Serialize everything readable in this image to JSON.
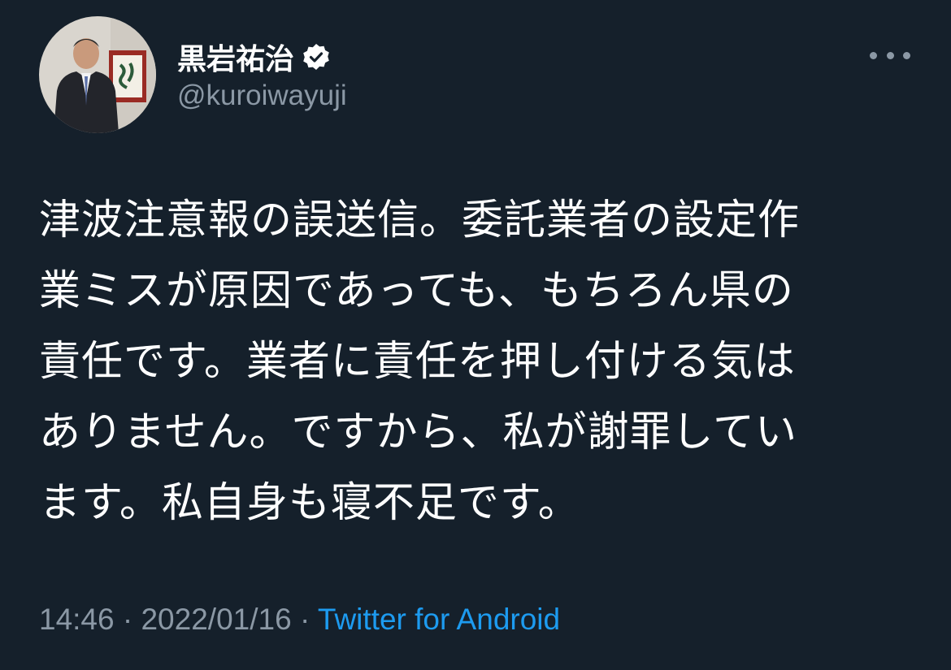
{
  "tweet": {
    "author": {
      "display_name": "黒岩祐治",
      "handle": "@kuroiwayuji",
      "verified": true,
      "avatar_icon": "profile-photo"
    },
    "more_icon": "more-horizontal-icon",
    "text_lines": [
      "津波注意報の誤送信。委託業者の設定作",
      "業ミスが原因であっても、もちろん県の",
      "責任です。業者に責任を押し付ける気は",
      "ありません。ですから、私が謝罪してい",
      "ます。私自身も寝不足です。"
    ],
    "time": "14:46",
    "separator": "·",
    "date": "2022/01/16",
    "source": "Twitter for Android"
  },
  "colors": {
    "background": "#15202b",
    "text_primary": "#ffffff",
    "text_secondary": "#8b98a5",
    "link": "#1d9bf0"
  }
}
